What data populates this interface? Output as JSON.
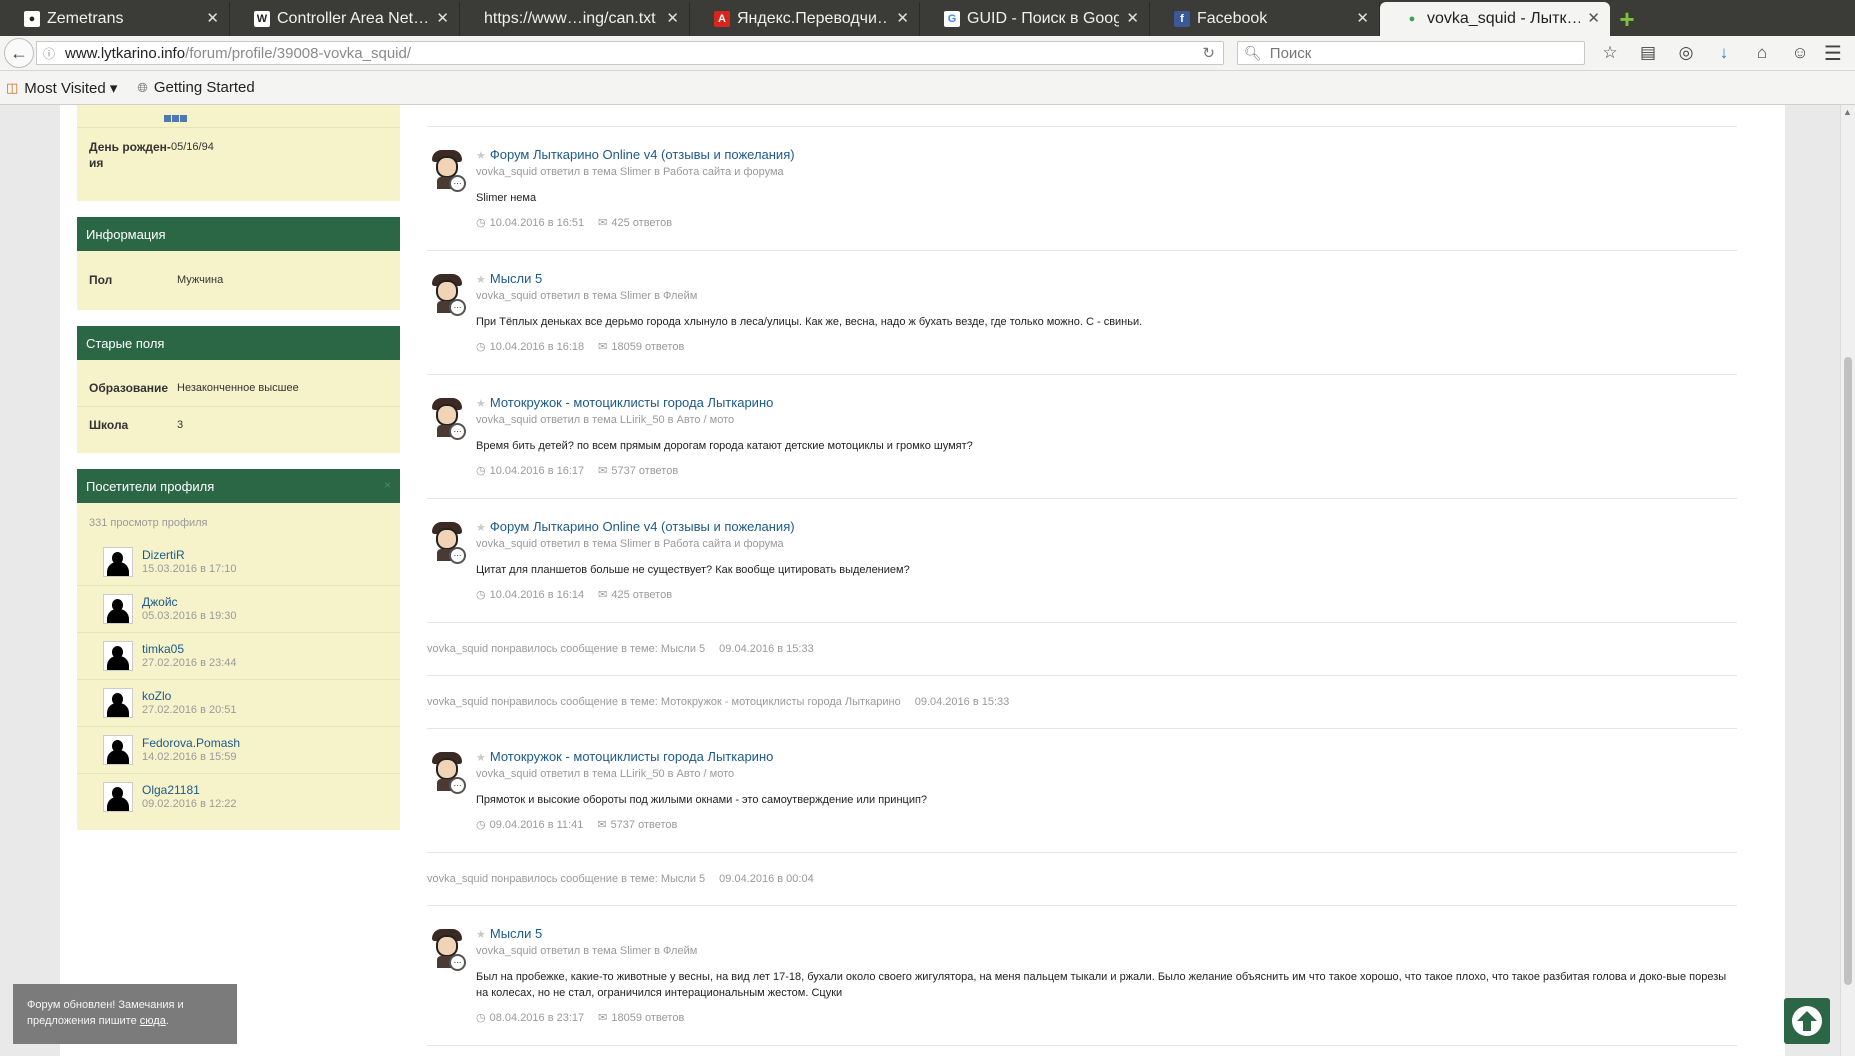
{
  "tabs": [
    {
      "label": "Zemetrans",
      "icon": "github-icon"
    },
    {
      "label": "Controller Area Net…",
      "icon": "wikipedia-icon"
    },
    {
      "label": "https://www…ing/can.txt",
      "icon": "none"
    },
    {
      "label": "Яндекс.Переводчи…",
      "icon": "yandex-translate-icon"
    },
    {
      "label": "GUID - Поиск в Google",
      "icon": "google-icon"
    },
    {
      "label": "Facebook",
      "icon": "facebook-icon"
    },
    {
      "label": "vovka_squid - Лытк…",
      "icon": "site-icon",
      "active": true
    }
  ],
  "navbar": {
    "url_host": "www.lytkarino.info",
    "url_path": "/forum/profile/39008-vovka_squid/",
    "search_placeholder": "Поиск"
  },
  "bookmarks": [
    {
      "label": "Most Visited ▾",
      "icon": "bookmarks-folder-icon"
    },
    {
      "label": "Getting Started",
      "icon": "firefox-icon"
    }
  ],
  "sidebar": {
    "top_box": {
      "birthday_label": "День рожден-ия",
      "birthday_value": "05/16/94"
    },
    "info_box": {
      "title": "Информация",
      "gender_label": "Пол",
      "gender_value": "Мужчина"
    },
    "old_fields_box": {
      "title": "Старые поля",
      "education_label": "Образование",
      "education_value": "Незаконченное высшее",
      "school_label": "Школа",
      "school_value": "3"
    },
    "visitors_box": {
      "title": "Посетители профиля",
      "close": "×",
      "views": "331 просмотр профиля",
      "visitors": [
        {
          "name": "DizertiR",
          "date": "15.03.2016 в 17:10"
        },
        {
          "name": "Джойс",
          "date": "05.03.2016 в 19:30"
        },
        {
          "name": "timka05",
          "date": "27.02.2016 в 23:44"
        },
        {
          "name": "koZlo",
          "date": "27.02.2016 в 20:51"
        },
        {
          "name": "Fedorova.Pomash",
          "date": "14.02.2016 в 15:59"
        },
        {
          "name": "Olga21181",
          "date": "09.02.2016 в 12:22"
        }
      ]
    }
  },
  "feed": [
    {
      "type": "post",
      "title": "Форум Лыткарино Online v4 (отзывы и пожелания)",
      "meta": "vovka_squid ответил в тема Slimer в Работа сайта и форума",
      "message": "Slimer нема",
      "date": "10.04.2016 в 16:51",
      "replies": "425 ответов"
    },
    {
      "type": "post",
      "title": "Мысли 5",
      "meta": "vovka_squid ответил в тема Slimer в Флейм",
      "message": "При Тёплых деньках все дерьмо города хлынуло в леса/улицы. Как же, весна, надо ж бухать везде, где только можно. С - свиньи.",
      "date": "10.04.2016 в 16:18",
      "replies": "18059 ответов"
    },
    {
      "type": "post",
      "title": "Мотокружок - мотоциклисты города Лыткарино",
      "meta": "vovka_squid ответил в тема LLirik_50 в Авто / мото",
      "message": "Время бить детей? по всем прямым дорогам города катают детские мотоциклы и громко шумят?",
      "date": "10.04.2016 в 16:17",
      "replies": "5737 ответов"
    },
    {
      "type": "post",
      "title": "Форум Лыткарино Online v4 (отзывы и пожелания)",
      "meta": "vovka_squid ответил в тема Slimer в Работа сайта и форума",
      "message": "Цитат для планшетов больше не существует? Как вообще цитировать выделением?",
      "date": "10.04.2016 в 16:14",
      "replies": "425 ответов"
    },
    {
      "type": "like",
      "text": "vovka_squid понравилось сообщение в теме: Мысли 5",
      "date": "09.04.2016 в 15:33"
    },
    {
      "type": "like",
      "text": "vovka_squid понравилось сообщение в теме: Мотокружок - мотоциклисты города Лыткарино",
      "date": "09.04.2016 в 15:33"
    },
    {
      "type": "post",
      "title": "Мотокружок - мотоциклисты города Лыткарино",
      "meta": "vovka_squid ответил в тема LLirik_50 в Авто / мото",
      "message": "Прямоток и высокие обороты под жилыми окнами - это самоутверждение или принцип?",
      "date": "09.04.2016 в 11:41",
      "replies": "5737 ответов"
    },
    {
      "type": "like",
      "text": "vovka_squid понравилось сообщение в теме: Мысли 5",
      "date": "09.04.2016 в 00:04"
    },
    {
      "type": "post",
      "title": "Мысли 5",
      "meta": "vovka_squid ответил в тема Slimer в Флейм",
      "message": "Был на пробежке, какие-то животные у весны, на вид лет 17-18, бухали около своего жигулятора, на меня пальцем тыкали и ржали. Было желание объяснить им что такое хорошо, что такое плохо, что такое разбитая голова и доко-вые порезы на колесах, но не стал, ограничился интерациональным жестом. Сцуки",
      "date": "08.04.2016 в 23:17",
      "replies": "18059 ответов"
    }
  ],
  "toast": {
    "text": "Форум обновлен! Замечания и предложения пишите ",
    "link": "сюда",
    "end": "."
  },
  "colors": {
    "accent": "#2b6744",
    "sidebar_bg": "#f6f3cb",
    "link": "#1c5a8a"
  }
}
